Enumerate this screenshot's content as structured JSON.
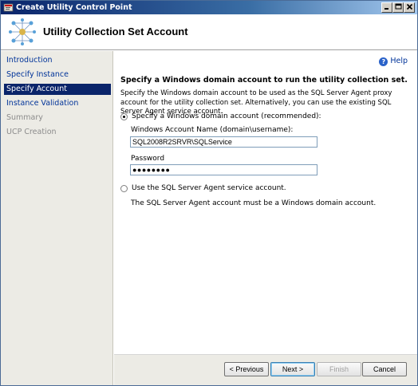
{
  "window": {
    "title": "Create Utility Control Point"
  },
  "header": {
    "title": "Utility Collection Set Account"
  },
  "sidebar": {
    "items": [
      {
        "label": "Introduction",
        "state": "link"
      },
      {
        "label": "Specify Instance",
        "state": "link"
      },
      {
        "label": "Specify Account",
        "state": "active"
      },
      {
        "label": "Instance Validation",
        "state": "link"
      },
      {
        "label": "Summary",
        "state": "disabled"
      },
      {
        "label": "UCP Creation",
        "state": "disabled"
      }
    ]
  },
  "help": {
    "label": "Help"
  },
  "main": {
    "heading": "Specify a Windows domain account to run the utility collection set.",
    "description": "Specify the Windows domain account to be used as the SQL Server Agent proxy account for the utility collection set. Alternatively, you can use the existing SQL Server Agent service account.",
    "option_domain": {
      "label": "Specify a Windows domain account (recommended):",
      "checked": true
    },
    "account_name": {
      "label": "Windows Account Name (domain\\username):",
      "value": "SQL2008R2SRVR\\SQLService"
    },
    "password": {
      "label": "Password",
      "value": "●●●●●●●●"
    },
    "option_agent": {
      "label": "Use the SQL Server Agent service account.",
      "checked": false
    },
    "agent_note": "The SQL Server Agent account must be a Windows domain account."
  },
  "buttons": {
    "previous": "< Previous",
    "next": "Next >",
    "finish": "Finish",
    "cancel": "Cancel"
  }
}
